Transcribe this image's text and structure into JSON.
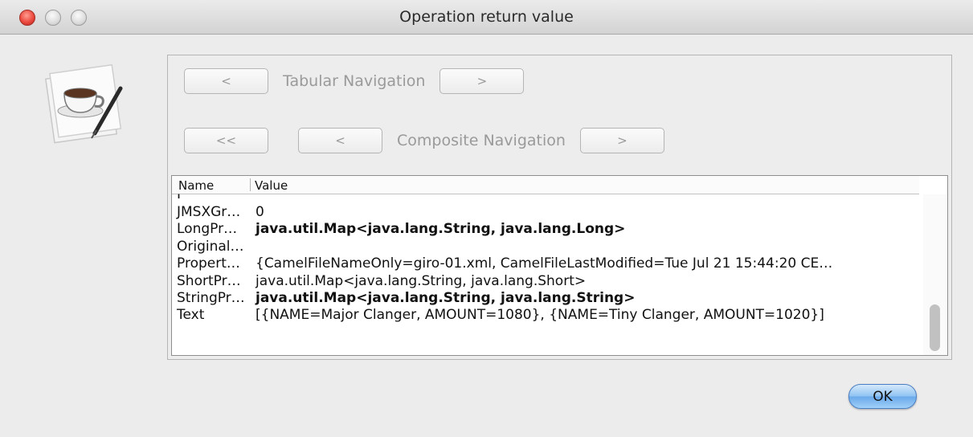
{
  "window": {
    "title": "Operation return value",
    "accent": "#6aa9ea",
    "close_color": "#ec4a3f"
  },
  "dialog_icon": "coffee-cup-pen-icon",
  "tabular_navigation": {
    "prev_label": "<",
    "label": "Tabular Navigation",
    "next_label": ">"
  },
  "composite_navigation": {
    "first_label": "<<",
    "prev_label": "<",
    "label": "Composite Navigation",
    "next_label": ">"
  },
  "table": {
    "columns": [
      "Name",
      "Value"
    ],
    "rows": [
      {
        "name": "JMSXGr…",
        "value": "0",
        "bold": false
      },
      {
        "name": "LongPr…",
        "value": "java.util.Map<java.lang.String, java.lang.Long>",
        "bold": true
      },
      {
        "name": "Original…",
        "value": "",
        "bold": false
      },
      {
        "name": "Propert…",
        "value": "{CamelFileNameOnly=giro-01.xml, CamelFileLastModified=Tue Jul 21 15:44:20 CE…",
        "bold": false
      },
      {
        "name": "ShortPr…",
        "value": "java.util.Map<java.lang.String, java.lang.Short>",
        "bold": false
      },
      {
        "name": "StringPr…",
        "value": "java.util.Map<java.lang.String, java.lang.String>",
        "bold": true
      },
      {
        "name": "Text",
        "value": "[{NAME=Major Clanger, AMOUNT=1080}, {NAME=Tiny Clanger, AMOUNT=1020}]",
        "bold": false
      }
    ]
  },
  "ok_button": {
    "label": "OK"
  }
}
